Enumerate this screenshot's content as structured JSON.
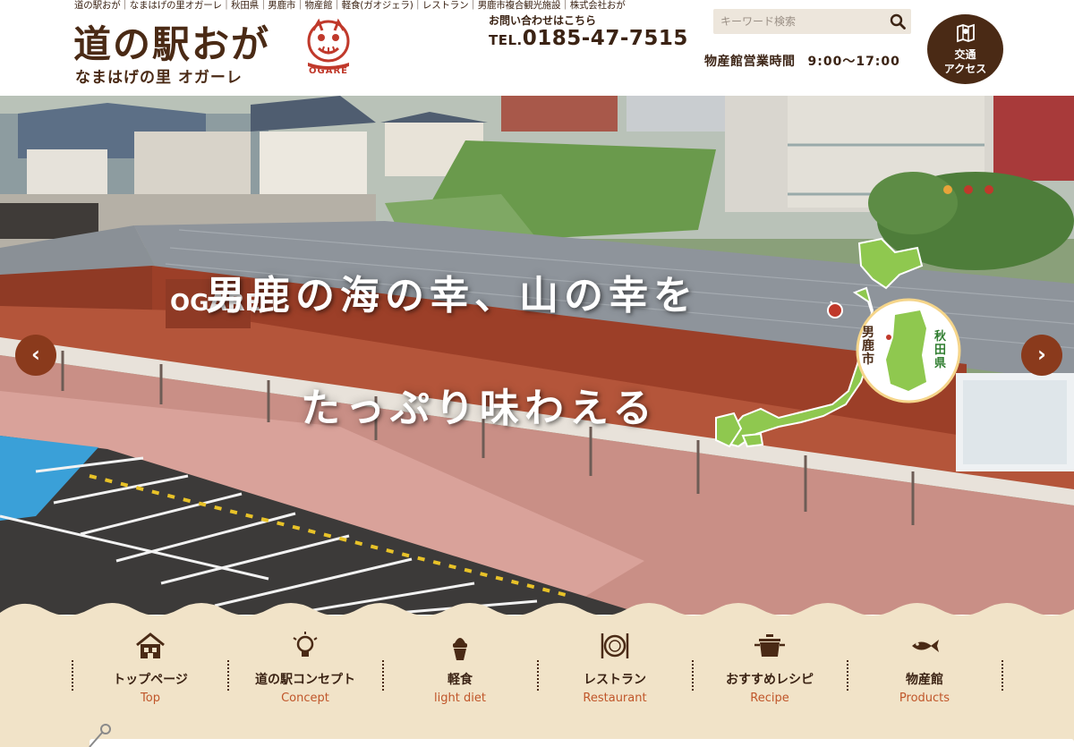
{
  "header": {
    "tagline": "道の駅おが｜なまはげの里オガーレ｜秋田県｜男鹿市｜物産館｜軽食(ガオジェラ)｜レストラン｜男鹿市複合観光施設｜株式会社おが",
    "logo_title": "道の駅おが",
    "logo_subtitle": "なまはげの里 オガーレ",
    "logo_mark_label": "OGARE",
    "contact_label": "お問い合わせはこちら",
    "tel_prefix": "TEL.",
    "tel_number": "0185-47-7515",
    "search_placeholder": "キーワード検索",
    "hours_label": "物産館営業時間",
    "hours_time": "9:00〜17:00",
    "access_line1": "交通",
    "access_line2": "アクセス"
  },
  "hero": {
    "line1": "男鹿の海の幸、山の幸を",
    "line2": "たっぷり味わえる",
    "map_city": "男鹿市",
    "map_pref": "秋田県",
    "building_sign": "OGARE",
    "prev_glyph": "‹",
    "next_glyph": "›",
    "slide_count": 3,
    "active_slide": 1
  },
  "nav": {
    "items": [
      {
        "jp": "トップページ",
        "en": "Top",
        "icon": "house-icon"
      },
      {
        "jp": "道の駅コンセプト",
        "en": "Concept",
        "icon": "lightbulb-icon"
      },
      {
        "jp": "軽食",
        "en": "light diet",
        "icon": "soft-serve-icon"
      },
      {
        "jp": "レストラン",
        "en": "Restaurant",
        "icon": "cutlery-icon"
      },
      {
        "jp": "おすすめレシピ",
        "en": "Recipe",
        "icon": "pot-icon"
      },
      {
        "jp": "物産館",
        "en": "Products",
        "icon": "fish-icon"
      }
    ]
  },
  "colors": {
    "brand_brown": "#4a2a15",
    "accent_red": "#c0392b",
    "nav_english": "#c0562a",
    "nav_background": "#f1e3c8",
    "dot_active": "#e8a33a",
    "dot_inactive": "#c0392b"
  }
}
